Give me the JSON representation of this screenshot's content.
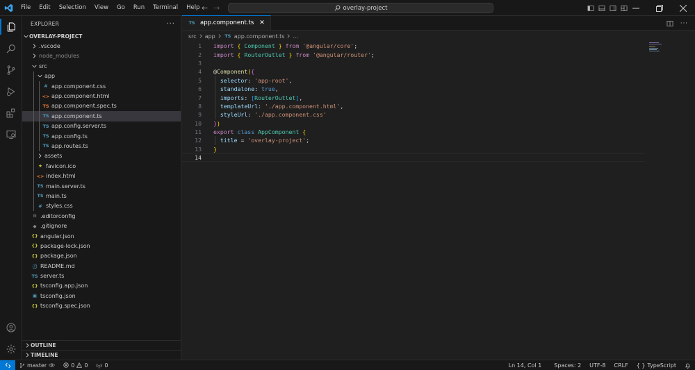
{
  "titlebar": {
    "menu": [
      "File",
      "Edit",
      "Selection",
      "View",
      "Go",
      "Run",
      "Terminal",
      "Help"
    ],
    "search_text": "overlay-project",
    "colors": {
      "brand": "#0078d4"
    }
  },
  "explorer": {
    "header": "EXPLORER",
    "root": "OVERLAY-PROJECT",
    "items": [
      {
        "label": ".vscode",
        "type": "folder",
        "depth": 1,
        "expanded": false
      },
      {
        "label": "node_modules",
        "type": "folder",
        "depth": 1,
        "expanded": false,
        "dim": true
      },
      {
        "label": "src",
        "type": "folder",
        "depth": 1,
        "expanded": true
      },
      {
        "label": "app",
        "type": "folder",
        "depth": 2,
        "expanded": true
      },
      {
        "label": "app.component.css",
        "type": "file",
        "depth": 3,
        "icon": "css-icon",
        "glyph": "#"
      },
      {
        "label": "app.component.html",
        "type": "file",
        "depth": 3,
        "icon": "html-icon",
        "glyph": "<>"
      },
      {
        "label": "app.component.spec.ts",
        "type": "file",
        "depth": 3,
        "icon": "spec-ts-icon",
        "glyph": "TS"
      },
      {
        "label": "app.component.ts",
        "type": "file",
        "depth": 3,
        "icon": "ts-icon",
        "glyph": "TS",
        "selected": true
      },
      {
        "label": "app.config.server.ts",
        "type": "file",
        "depth": 3,
        "icon": "ts-icon",
        "glyph": "TS"
      },
      {
        "label": "app.config.ts",
        "type": "file",
        "depth": 3,
        "icon": "ts-icon",
        "glyph": "TS"
      },
      {
        "label": "app.routes.ts",
        "type": "file",
        "depth": 3,
        "icon": "ts-icon",
        "glyph": "TS"
      },
      {
        "label": "assets",
        "type": "folder",
        "depth": 2,
        "expanded": false
      },
      {
        "label": "favicon.ico",
        "type": "file",
        "depth": 2,
        "icon": "favicon-icon",
        "glyph": "★"
      },
      {
        "label": "index.html",
        "type": "file",
        "depth": 2,
        "icon": "html-icon",
        "glyph": "<>"
      },
      {
        "label": "main.server.ts",
        "type": "file",
        "depth": 2,
        "icon": "ts-icon",
        "glyph": "TS"
      },
      {
        "label": "main.ts",
        "type": "file",
        "depth": 2,
        "icon": "ts-icon",
        "glyph": "TS"
      },
      {
        "label": "styles.css",
        "type": "file",
        "depth": 2,
        "icon": "css-icon",
        "glyph": "#"
      },
      {
        "label": ".editorconfig",
        "type": "file",
        "depth": 1,
        "icon": "gear-icon",
        "glyph": "⚙"
      },
      {
        "label": ".gitignore",
        "type": "file",
        "depth": 1,
        "icon": "git-icon",
        "glyph": "◆"
      },
      {
        "label": "angular.json",
        "type": "file",
        "depth": 1,
        "icon": "json-icon",
        "glyph": "{}"
      },
      {
        "label": "package-lock.json",
        "type": "file",
        "depth": 1,
        "icon": "json-icon",
        "glyph": "{}"
      },
      {
        "label": "package.json",
        "type": "file",
        "depth": 1,
        "icon": "json-icon",
        "glyph": "{}"
      },
      {
        "label": "README.md",
        "type": "file",
        "depth": 1,
        "icon": "info-icon",
        "glyph": "ⓘ"
      },
      {
        "label": "server.ts",
        "type": "file",
        "depth": 1,
        "icon": "ts-icon",
        "glyph": "TS"
      },
      {
        "label": "tsconfig.app.json",
        "type": "file",
        "depth": 1,
        "icon": "json-icon",
        "glyph": "{}"
      },
      {
        "label": "tsconfig.json",
        "type": "file",
        "depth": 1,
        "icon": "tsconfig-icon",
        "glyph": "▣"
      },
      {
        "label": "tsconfig.spec.json",
        "type": "file",
        "depth": 1,
        "icon": "json-icon",
        "glyph": "{}"
      }
    ],
    "outline_label": "OUTLINE",
    "timeline_label": "TIMELINE"
  },
  "editor": {
    "tab_label": "app.component.ts",
    "tab_icon": "TS",
    "breadcrumb": [
      "src",
      "app",
      "app.component.ts",
      "..."
    ],
    "current_line": 14,
    "lines": [
      {
        "n": "1",
        "tokens": [
          [
            "kw-imp",
            "import"
          ],
          [
            "plain",
            " "
          ],
          [
            "brace",
            "{"
          ],
          [
            "plain",
            " "
          ],
          [
            "cls",
            "Component"
          ],
          [
            "plain",
            " "
          ],
          [
            "brace",
            "}"
          ],
          [
            "plain",
            " "
          ],
          [
            "kw-imp",
            "from"
          ],
          [
            "plain",
            " "
          ],
          [
            "str",
            "'@angular/core'"
          ],
          [
            "plain",
            ";"
          ]
        ]
      },
      {
        "n": "2",
        "tokens": [
          [
            "kw-imp",
            "import"
          ],
          [
            "plain",
            " "
          ],
          [
            "brace",
            "{"
          ],
          [
            "plain",
            " "
          ],
          [
            "cls",
            "RouterOutlet"
          ],
          [
            "plain",
            " "
          ],
          [
            "brace",
            "}"
          ],
          [
            "plain",
            " "
          ],
          [
            "kw-imp",
            "from"
          ],
          [
            "plain",
            " "
          ],
          [
            "str",
            "'@angular/router'"
          ],
          [
            "plain",
            ";"
          ]
        ]
      },
      {
        "n": "3",
        "tokens": []
      },
      {
        "n": "4",
        "tokens": [
          [
            "plain",
            "@"
          ],
          [
            "deco",
            "Component"
          ],
          [
            "brace",
            "("
          ],
          [
            "brace2",
            "{"
          ]
        ]
      },
      {
        "n": "5",
        "tokens": [
          [
            "plain",
            "  "
          ],
          [
            "prop",
            "selector"
          ],
          [
            "plain",
            ": "
          ],
          [
            "str",
            "'app-root'"
          ],
          [
            "plain",
            ","
          ]
        ]
      },
      {
        "n": "6",
        "tokens": [
          [
            "plain",
            "  "
          ],
          [
            "prop",
            "standalone"
          ],
          [
            "plain",
            ": "
          ],
          [
            "kw",
            "true"
          ],
          [
            "plain",
            ","
          ]
        ]
      },
      {
        "n": "7",
        "tokens": [
          [
            "plain",
            "  "
          ],
          [
            "prop",
            "imports"
          ],
          [
            "plain",
            ": "
          ],
          [
            "brace3",
            "["
          ],
          [
            "cls",
            "RouterOutlet"
          ],
          [
            "brace3",
            "]"
          ],
          [
            "plain",
            ","
          ]
        ]
      },
      {
        "n": "8",
        "tokens": [
          [
            "plain",
            "  "
          ],
          [
            "prop",
            "templateUrl"
          ],
          [
            "plain",
            ": "
          ],
          [
            "str",
            "'./app.component.html'"
          ],
          [
            "plain",
            ","
          ]
        ]
      },
      {
        "n": "9",
        "tokens": [
          [
            "plain",
            "  "
          ],
          [
            "prop",
            "styleUrl"
          ],
          [
            "plain",
            ": "
          ],
          [
            "str",
            "'./app.component.css'"
          ]
        ]
      },
      {
        "n": "10",
        "tokens": [
          [
            "brace2",
            "}"
          ],
          [
            "brace",
            ")"
          ]
        ]
      },
      {
        "n": "11",
        "tokens": [
          [
            "kw-imp",
            "export"
          ],
          [
            "plain",
            " "
          ],
          [
            "kw",
            "class"
          ],
          [
            "plain",
            " "
          ],
          [
            "cls",
            "AppComponent"
          ],
          [
            "plain",
            " "
          ],
          [
            "brace",
            "{"
          ]
        ]
      },
      {
        "n": "12",
        "tokens": [
          [
            "plain",
            "  "
          ],
          [
            "prop",
            "title"
          ],
          [
            "plain",
            " = "
          ],
          [
            "str",
            "'overlay-project'"
          ],
          [
            "plain",
            ";"
          ]
        ]
      },
      {
        "n": "13",
        "tokens": [
          [
            "brace",
            "}"
          ]
        ]
      },
      {
        "n": "14",
        "tokens": []
      }
    ]
  },
  "statusbar": {
    "branch": "master",
    "errors": "0",
    "warnings": "0",
    "ports": "0",
    "position": "Ln 14, Col 1",
    "spaces": "Spaces: 2",
    "encoding": "UTF-8",
    "eol": "CRLF",
    "language": "TypeScript",
    "language_glyph": "{ }"
  }
}
